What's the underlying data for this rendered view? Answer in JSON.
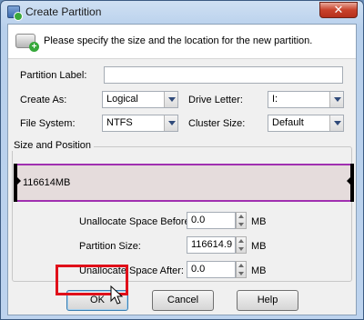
{
  "window": {
    "title": "Create Partition",
    "close_glyph": "✕"
  },
  "header": {
    "text": "Please specify the size and the location for the new partition."
  },
  "form": {
    "partition_label": {
      "label": "Partition Label:",
      "value": ""
    },
    "create_as": {
      "label": "Create As:",
      "value": "Logical"
    },
    "drive_letter": {
      "label": "Drive Letter:",
      "value": "I:"
    },
    "file_system": {
      "label": "File System:",
      "value": "NTFS"
    },
    "cluster_size": {
      "label": "Cluster Size:",
      "value": "Default"
    }
  },
  "size_position": {
    "title": "Size and Position",
    "partition_size_text": "116614MB",
    "unallocated_before": {
      "label": "Unallocate Space Before:",
      "value": "0.0",
      "unit": "MB"
    },
    "partition_size": {
      "label": "Partition Size:",
      "value": "116614.9",
      "unit": "MB"
    },
    "unallocated_after": {
      "label": "Unallocate Space After:",
      "value": "0.0",
      "unit": "MB"
    }
  },
  "buttons": {
    "ok": "OK",
    "cancel": "Cancel",
    "help": "Help"
  },
  "colors": {
    "partition_border": "#a030b0",
    "highlight": "#e0101a"
  }
}
